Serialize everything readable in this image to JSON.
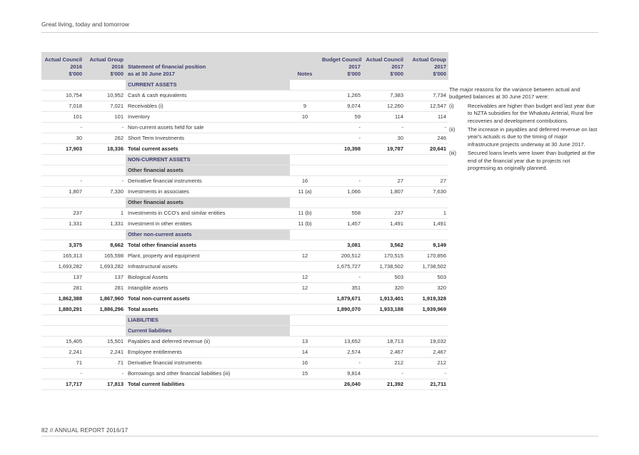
{
  "header": {
    "text": "Great living, today and tomorrow"
  },
  "footer": {
    "text": "82 // ANNUAL REPORT 2016/17"
  },
  "table": {
    "head": {
      "c1": [
        "Actual Council",
        "2016",
        "$'000"
      ],
      "c2": [
        "Actual Group",
        "2016",
        "$'000"
      ],
      "desc": [
        "Statement of financial position",
        "as at 30 June 2017"
      ],
      "notes": "Notes",
      "c3": [
        "Budget Council",
        "2017",
        "$'000"
      ],
      "c4": [
        "Actual Council",
        "2017",
        "$'000"
      ],
      "c5": [
        "Actual Group",
        "2017",
        "$'000"
      ]
    },
    "rows": [
      {
        "type": "section",
        "d": "CURRENT ASSETS",
        "a": "",
        "b": "",
        "n": "",
        "c": "",
        "e": "",
        "f": ""
      },
      {
        "type": "row",
        "a": "10,754",
        "b": "10,952",
        "d": "Cash & cash equivalents",
        "n": "",
        "c": "1,265",
        "e": "7,383",
        "f": "7,734"
      },
      {
        "type": "row",
        "a": "7,018",
        "b": "7,021",
        "d": "Receivables (i)",
        "n": "9",
        "c": "9,074",
        "e": "12,260",
        "f": "12,547"
      },
      {
        "type": "row",
        "a": "101",
        "b": "101",
        "d": "Inventory",
        "n": "10",
        "c": "59",
        "e": "114",
        "f": "114"
      },
      {
        "type": "row",
        "a": "-",
        "b": "-",
        "d": "Non-current assets held for sale",
        "n": "",
        "c": "-",
        "e": "-",
        "f": "-"
      },
      {
        "type": "row",
        "a": "30",
        "b": "262",
        "d": "Short Term Investments",
        "n": "",
        "c": "-",
        "e": "30",
        "f": "246"
      },
      {
        "type": "total",
        "a": "17,903",
        "b": "18,336",
        "d": "Total current assets",
        "n": "",
        "c": "10,398",
        "e": "19,787",
        "f": "20,641"
      },
      {
        "type": "section",
        "d": "NON-CURRENT ASSETS",
        "a": "",
        "b": "",
        "n": "",
        "c": "",
        "e": "",
        "f": ""
      },
      {
        "type": "sub",
        "d": "Other financial assets",
        "a": "",
        "b": "",
        "n": "",
        "c": "",
        "e": "",
        "f": ""
      },
      {
        "type": "row",
        "a": "-",
        "b": "-",
        "d": "Derivative financial instruments",
        "n": "16",
        "c": "-",
        "e": "27",
        "f": "27"
      },
      {
        "type": "row",
        "a": "1,807",
        "b": "7,330",
        "d": "Investments in associates",
        "n": "11 (a)",
        "c": "1,066",
        "e": "1,807",
        "f": "7,630"
      },
      {
        "type": "sub",
        "d": "Other financial assets",
        "a": "",
        "b": "",
        "n": "",
        "c": "",
        "e": "",
        "f": ""
      },
      {
        "type": "row",
        "a": "237",
        "b": "1",
        "d": "Investments in CCO's and similar entities",
        "n": "11 (b)",
        "c": "558",
        "e": "237",
        "f": "1"
      },
      {
        "type": "row",
        "a": "1,331",
        "b": "1,331",
        "d": "Investment in other entities",
        "n": "11 (b)",
        "c": "1,457",
        "e": "1,491",
        "f": "1,491"
      },
      {
        "type": "section",
        "d": "Other non-current assets",
        "a": "",
        "b": "",
        "n": "",
        "c": "",
        "e": "",
        "f": ""
      },
      {
        "type": "total",
        "a": "3,375",
        "b": "8,662",
        "d": "Total other financial assets",
        "n": "",
        "c": "3,081",
        "e": "3,562",
        "f": "9,149"
      },
      {
        "type": "row",
        "a": "165,313",
        "b": "165,598",
        "d": "Plant, property and equipment",
        "n": "12",
        "c": "200,512",
        "e": "170,515",
        "f": "170,856"
      },
      {
        "type": "row",
        "a": "1,693,282",
        "b": "1,693,282",
        "d": "Infrastructural assets",
        "n": "",
        "c": "1,675,727",
        "e": "1,738,502",
        "f": "1,738,502"
      },
      {
        "type": "row",
        "a": "137",
        "b": "137",
        "d": "Biological Assets",
        "n": "12",
        "c": "-",
        "e": "503",
        "f": "503"
      },
      {
        "type": "row",
        "a": "281",
        "b": "281",
        "d": "Intangible assets",
        "n": "12",
        "c": "351",
        "e": "320",
        "f": "320"
      },
      {
        "type": "total",
        "a": "1,862,388",
        "b": "1,867,960",
        "d": "Total non-current assets",
        "n": "",
        "c": "1,879,671",
        "e": "1,913,401",
        "f": "1,919,328"
      },
      {
        "type": "total",
        "a": "1,880,291",
        "b": "1,886,296",
        "d": "Total assets",
        "n": "",
        "c": "1,890,070",
        "e": "1,933,188",
        "f": "1,939,969"
      },
      {
        "type": "section",
        "d": "LIABILITIES",
        "a": "",
        "b": "",
        "n": "",
        "c": "",
        "e": "",
        "f": ""
      },
      {
        "type": "section",
        "d": "Current liabilities",
        "a": "",
        "b": "",
        "n": "",
        "c": "",
        "e": "",
        "f": ""
      },
      {
        "type": "row",
        "a": "15,405",
        "b": "15,501",
        "d": "Payables and deferred revenue (ii)",
        "n": "13",
        "c": "13,652",
        "e": "18,713",
        "f": "19,032"
      },
      {
        "type": "row",
        "a": "2,241",
        "b": "2,241",
        "d": "Employee entitlements",
        "n": "14",
        "c": "2,574",
        "e": "2,467",
        "f": "2,467"
      },
      {
        "type": "row",
        "a": "71",
        "b": "71",
        "d": "Derivative financial instruments",
        "n": "16",
        "c": "-",
        "e": "212",
        "f": "212"
      },
      {
        "type": "row",
        "a": "-",
        "b": "-",
        "d": "Borrowings and other financial liabilities (iii)",
        "n": "15",
        "c": "9,814",
        "e": "-",
        "f": "-"
      },
      {
        "type": "total",
        "a": "17,717",
        "b": "17,813",
        "d": "Total current liabilities",
        "n": "",
        "c": "26,040",
        "e": "21,392",
        "f": "21,711"
      }
    ]
  },
  "sidebar": {
    "intro": "The major reasons for the variance between actual and budgeted balances at 30 June 2017 were:",
    "items": [
      {
        "marker": "(i)",
        "text": "Receivables are higher than budget and last year due to NZTA subsidies for the Whakatu Arterial, Rural fire recoveries and development contributions."
      },
      {
        "marker": "(ii)",
        "text": "The increase in payables and deferred revenue on last year's actuals is due to the timing of major infrastructure projects underway at 30 June 2017."
      },
      {
        "marker": "(iii)",
        "text": "Secured loans levels were lower than budgeted at the end of the financial year due to projects not progressing as originally planned."
      }
    ]
  }
}
